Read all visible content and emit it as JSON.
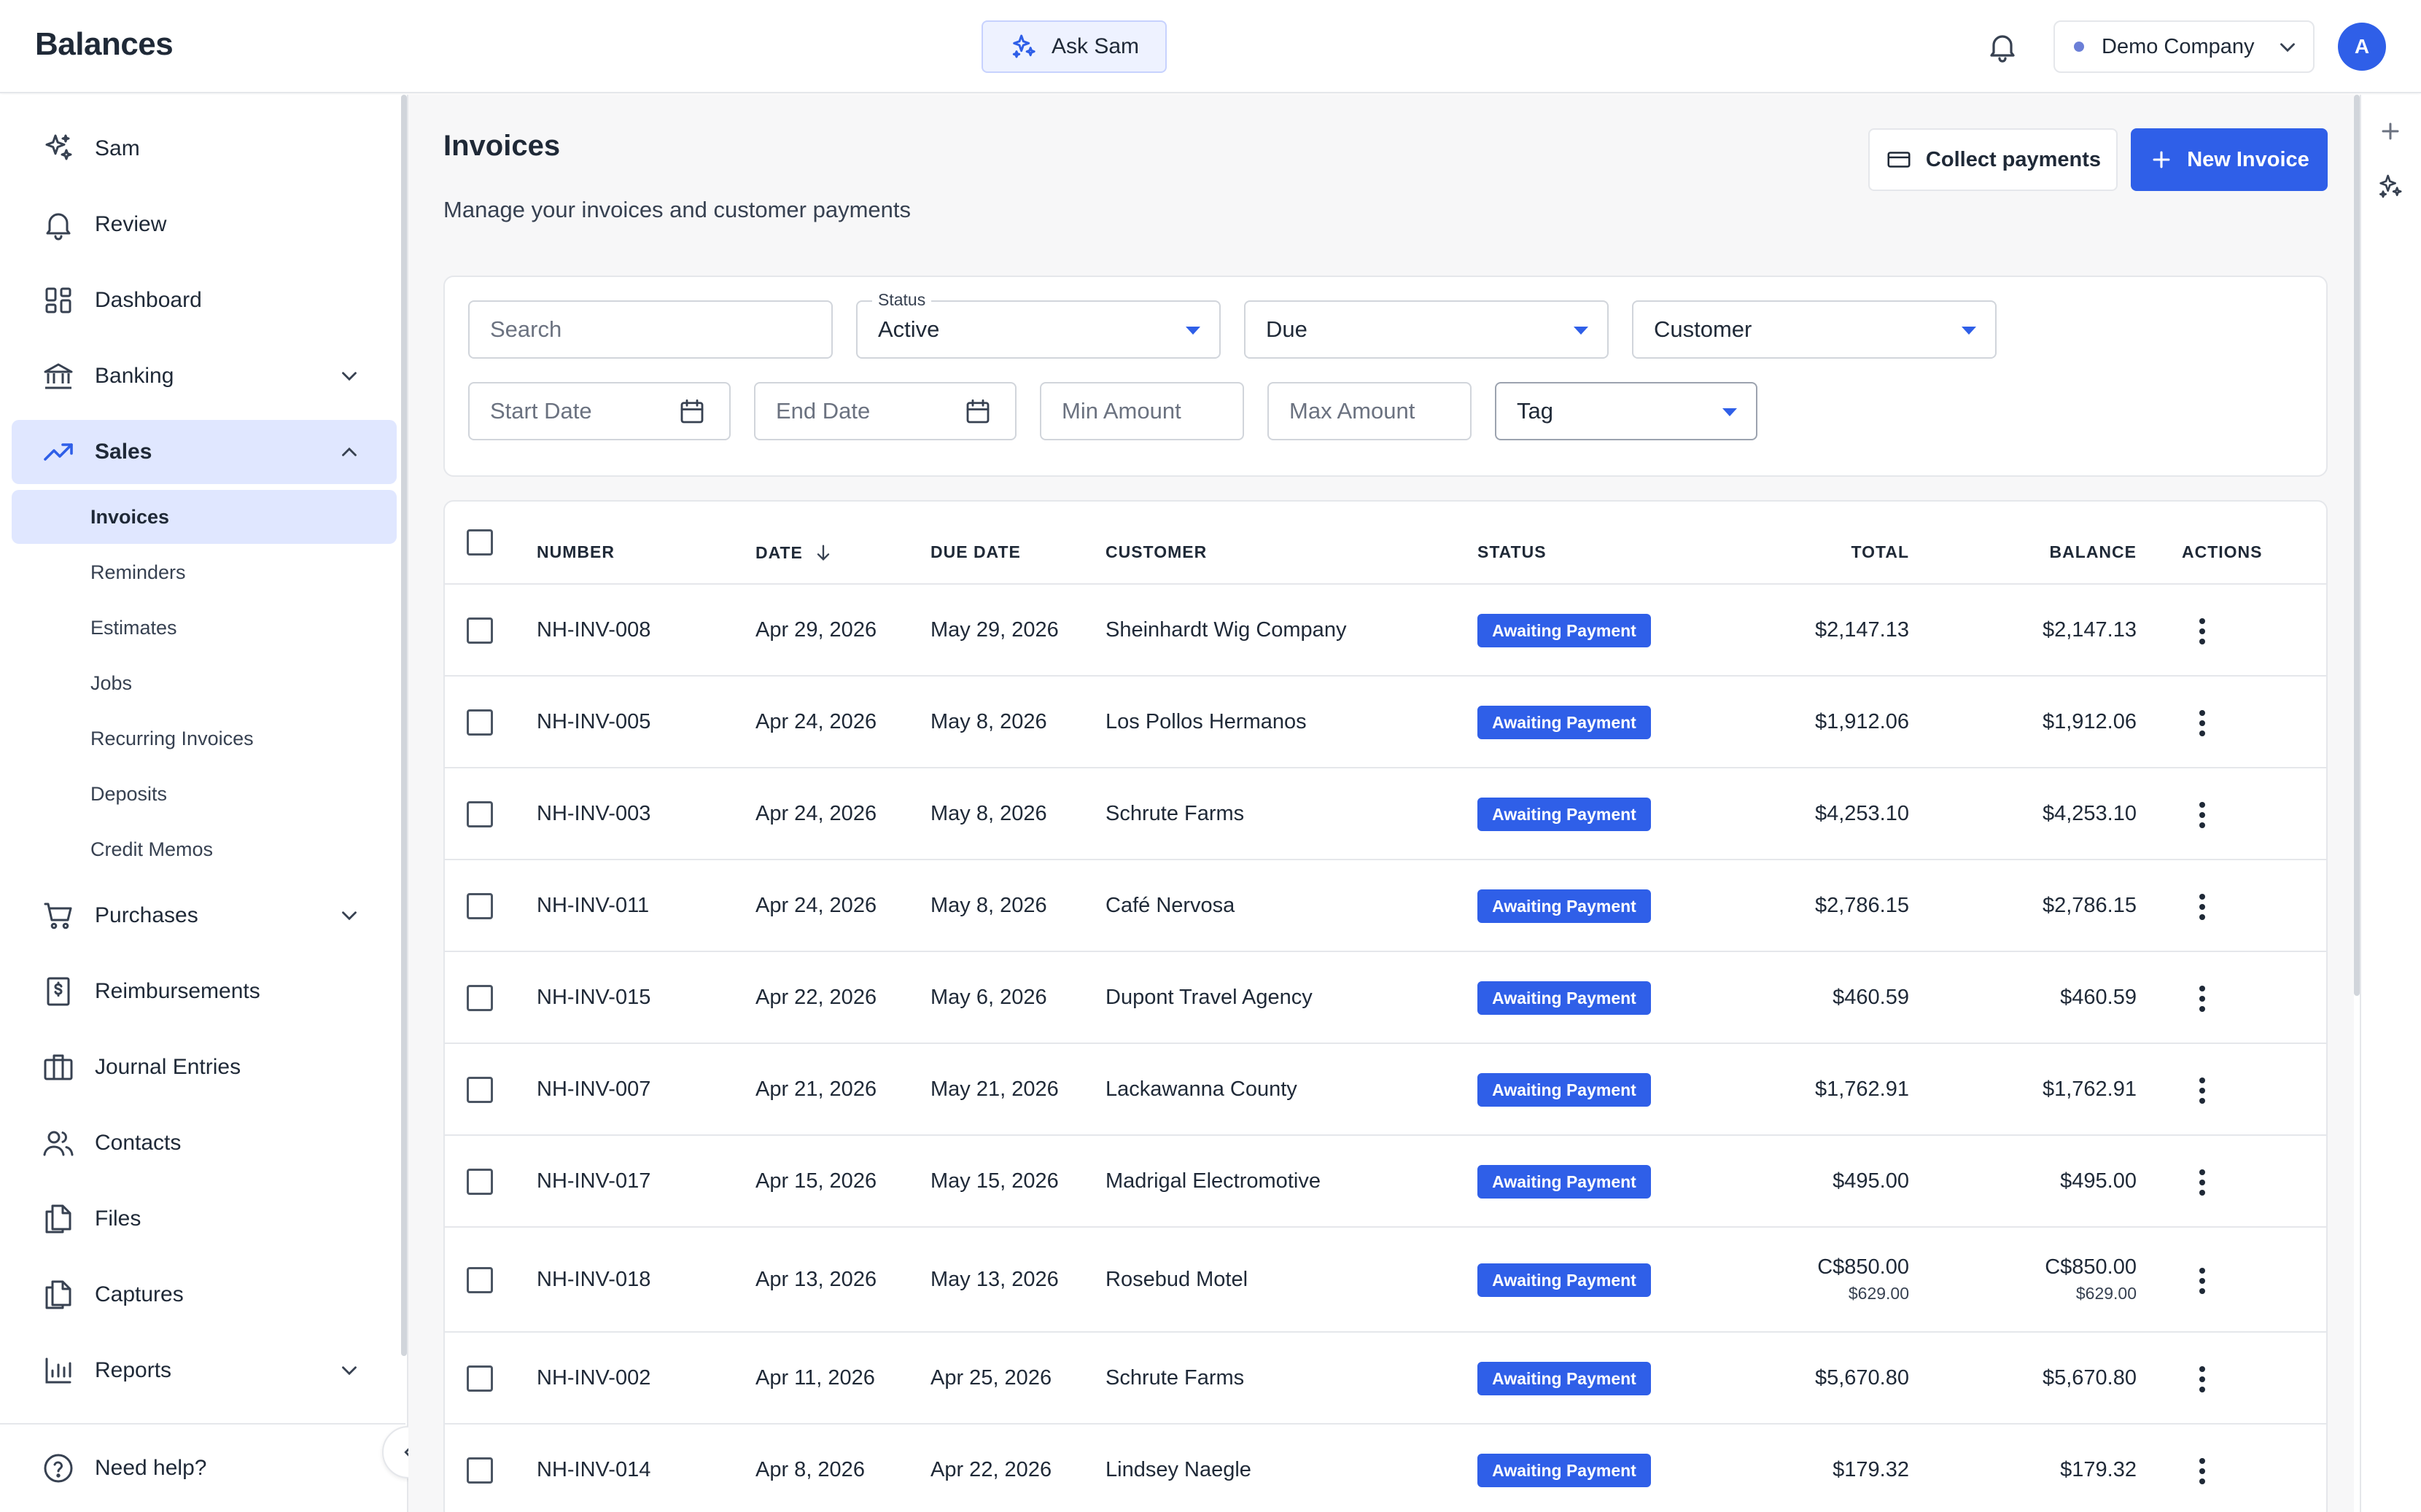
{
  "app": {
    "title": "Balances",
    "ask_label": "Ask Sam",
    "company": "Demo Company",
    "avatar_initial": "A",
    "accent_color": "#2f5fe8"
  },
  "sidebar": {
    "items": [
      {
        "label": "Sam",
        "icon": "sparkle-icon"
      },
      {
        "label": "Review",
        "icon": "bell-icon"
      },
      {
        "label": "Dashboard",
        "icon": "grid-icon"
      },
      {
        "label": "Banking",
        "icon": "bank-icon"
      },
      {
        "label": "Sales",
        "icon": "trending-up-icon"
      },
      {
        "label": "Purchases",
        "icon": "cart-icon"
      },
      {
        "label": "Reimbursements",
        "icon": "receipt-icon"
      },
      {
        "label": "Journal Entries",
        "icon": "book-icon"
      },
      {
        "label": "Contacts",
        "icon": "users-icon"
      },
      {
        "label": "Files",
        "icon": "files-icon"
      },
      {
        "label": "Captures",
        "icon": "captures-icon"
      },
      {
        "label": "Reports",
        "icon": "bar-chart-icon"
      }
    ],
    "sales_sub": [
      "Invoices",
      "Reminders",
      "Estimates",
      "Jobs",
      "Recurring Invoices",
      "Deposits",
      "Credit Memos"
    ],
    "help_label": "Need help?"
  },
  "page": {
    "title": "Invoices",
    "subtitle": "Manage your invoices and customer payments",
    "collect_label": "Collect payments",
    "new_label": "New Invoice"
  },
  "filters": {
    "search_placeholder": "Search",
    "status_label": "Status",
    "status_value": "Active",
    "due_value": "Due",
    "customer_value": "Customer",
    "start_date": "Start Date",
    "end_date": "End Date",
    "min_amount": "Min Amount",
    "max_amount": "Max Amount",
    "tag_value": "Tag"
  },
  "table": {
    "headers": {
      "number": "NUMBER",
      "date": "DATE",
      "due_date": "DUE DATE",
      "customer": "CUSTOMER",
      "status": "STATUS",
      "total": "TOTAL",
      "balance": "BALANCE",
      "actions": "ACTIONS"
    },
    "rows": [
      {
        "number": "NH-INV-008",
        "date": "Apr 29, 2026",
        "due": "May 29, 2026",
        "customer": "Sheinhardt Wig Company",
        "status": "Awaiting Payment",
        "total": "$2,147.13",
        "total_sub": "",
        "balance": "$2,147.13",
        "balance_sub": ""
      },
      {
        "number": "NH-INV-005",
        "date": "Apr 24, 2026",
        "due": "May 8, 2026",
        "customer": "Los Pollos Hermanos",
        "status": "Awaiting Payment",
        "total": "$1,912.06",
        "total_sub": "",
        "balance": "$1,912.06",
        "balance_sub": ""
      },
      {
        "number": "NH-INV-003",
        "date": "Apr 24, 2026",
        "due": "May 8, 2026",
        "customer": "Schrute Farms",
        "status": "Awaiting Payment",
        "total": "$4,253.10",
        "total_sub": "",
        "balance": "$4,253.10",
        "balance_sub": ""
      },
      {
        "number": "NH-INV-011",
        "date": "Apr 24, 2026",
        "due": "May 8, 2026",
        "customer": "Café Nervosa",
        "status": "Awaiting Payment",
        "total": "$2,786.15",
        "total_sub": "",
        "balance": "$2,786.15",
        "balance_sub": ""
      },
      {
        "number": "NH-INV-015",
        "date": "Apr 22, 2026",
        "due": "May 6, 2026",
        "customer": "Dupont Travel Agency",
        "status": "Awaiting Payment",
        "total": "$460.59",
        "total_sub": "",
        "balance": "$460.59",
        "balance_sub": ""
      },
      {
        "number": "NH-INV-007",
        "date": "Apr 21, 2026",
        "due": "May 21, 2026",
        "customer": "Lackawanna County",
        "status": "Awaiting Payment",
        "total": "$1,762.91",
        "total_sub": "",
        "balance": "$1,762.91",
        "balance_sub": ""
      },
      {
        "number": "NH-INV-017",
        "date": "Apr 15, 2026",
        "due": "May 15, 2026",
        "customer": "Madrigal Electromotive",
        "status": "Awaiting Payment",
        "total": "$495.00",
        "total_sub": "",
        "balance": "$495.00",
        "balance_sub": ""
      },
      {
        "number": "NH-INV-018",
        "date": "Apr 13, 2026",
        "due": "May 13, 2026",
        "customer": "Rosebud Motel",
        "status": "Awaiting Payment",
        "total": "C$850.00",
        "total_sub": "$629.00",
        "balance": "C$850.00",
        "balance_sub": "$629.00"
      },
      {
        "number": "NH-INV-002",
        "date": "Apr 11, 2026",
        "due": "Apr 25, 2026",
        "customer": "Schrute Farms",
        "status": "Awaiting Payment",
        "total": "$5,670.80",
        "total_sub": "",
        "balance": "$5,670.80",
        "balance_sub": ""
      },
      {
        "number": "NH-INV-014",
        "date": "Apr 8, 2026",
        "due": "Apr 22, 2026",
        "customer": "Lindsey Naegle",
        "status": "Awaiting Payment",
        "total": "$179.32",
        "total_sub": "",
        "balance": "$179.32",
        "balance_sub": ""
      }
    ]
  }
}
